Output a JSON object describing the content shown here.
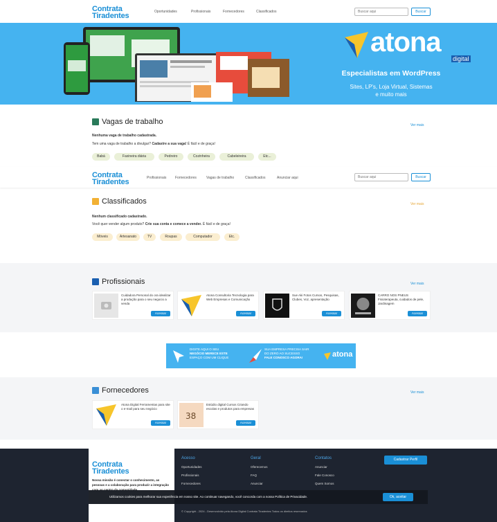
{
  "header": {
    "logo_line1": "Contrata",
    "logo_line2": "Tiradentes",
    "nav": [
      "Oportunidades",
      "Profissionais",
      "Fornecedores",
      "Classificados"
    ],
    "search_placeholder": "Buscar aqui",
    "search_button": "Buscar"
  },
  "header2": {
    "nav": [
      "Profissionais",
      "Fornecedores",
      "Vagas de trabalho",
      "Classificados",
      "Anunciar aqui"
    ]
  },
  "banner": {
    "brand": "atona",
    "brand_sub": "digital",
    "tagline": "Especialistas em WordPress",
    "line1": "Sites, LP's, Loja Virtual, Sistemas",
    "line2": "e muito mais"
  },
  "vagas": {
    "title": "Vagas de trabalho",
    "see_all": "Ver mais",
    "empty": "Nenhuma vaga de trabalho cadastrada.",
    "prompt_prefix": "Tem uma vaga de trabalho a divulgar?",
    "prompt_link": "Cadastre a sua vaga!",
    "prompt_suffix": "É fácil e de graça!",
    "tags": [
      "Babá",
      "Faxineira diária",
      "Pedreiro",
      "Cozinheira",
      "Cabeleireira",
      "Etc..."
    ]
  },
  "classificados": {
    "title": "Classificados",
    "see_all": "Ver mais",
    "empty": "Nenhum classificado cadastrado.",
    "prompt_prefix": "Você quer vender algum produto?",
    "prompt_link": "Crie sua conta e comece a vender.",
    "prompt_suffix": "É fácil e de graça!",
    "tags": [
      "Móveis",
      "Artesanato",
      "TV",
      "Roupas",
      "Computador",
      "Etc."
    ]
  },
  "profissionais": {
    "title": "Profissionais",
    "see_all": "Ver mais",
    "cards": [
      {
        "text": "Cuidadora Personal do ora idealizar a produção para o seu negocio a venda",
        "button": "Acessar"
      },
      {
        "text": "Atona Consultoria Tecnologia para Web Empresas e Comunicação",
        "button": "Acessar"
      },
      {
        "text": "Sue Aki Fotos Cursos, Pesquisas, Clubes, Voz, apresentação",
        "button": "Acessar"
      },
      {
        "text": "CARRO NOS PNEUS Fisioterapeuta, cuidados de pele, Jardinagem",
        "button": "Acessar"
      }
    ]
  },
  "ad": {
    "left_line1": "DIGITE AQUI O SEU",
    "left_line2": "NEGÓCIO MERECE ESTE",
    "left_line3": "ESPAÇO COM UM CLIQUE",
    "mid_line1": "SUA EMPRESA PRECISA SAIR",
    "mid_line2": "DO ZERO AO SUCESSO",
    "mid_line3": "FALE CONOSCO AGORA!",
    "brand": "atona"
  },
  "fornecedores": {
    "title": "Fornecedores",
    "see_all": "Ver mais",
    "cards": [
      {
        "text": "Atona Digital Ferramentas para site o e-mail para seu negócio",
        "button": "Acessar"
      },
      {
        "text": "Estúdio digital Cursos Criando escolas e produtos para empresas",
        "button": "Acessar"
      }
    ]
  },
  "footer": {
    "logo_line1": "Contrata",
    "logo_line2": "Tiradentes",
    "about": "Nossa missão é conectar o conhecimento, as pessoas e a colaboração para produzir a integração com ao centro da comunidade.",
    "col1_title": "Acesso",
    "col1": [
      "Oportunidades",
      "Profissionais",
      "Fornecedores"
    ],
    "col2_title": "Geral",
    "col2": [
      "Oferecemos",
      "FAQ",
      "Anunciar"
    ],
    "col3_title": "Contatos",
    "col3": [
      "Anunciar",
      "Fale Conosco",
      "Quem Somos"
    ],
    "cta": "Cadastrar Perfil",
    "copyright": "© Copyright - 2024 - Desenvolvido pela Atona Digital Contrata Tiradentes Todos os direitos reservados"
  },
  "cookie": {
    "text": "Utilizamos cookies para melhorar sua experiência em nosso site. Ao continuar navegando, você concorda com a nossa Política de Privacidade.",
    "button": "Ok, aceitar"
  },
  "colors": {
    "accent": "#1a8fd6",
    "banner": "#45b3f0",
    "pill_vagas": "#f0f0d0",
    "pill_class": "#fbf1d8",
    "footer": "#1e2430"
  }
}
